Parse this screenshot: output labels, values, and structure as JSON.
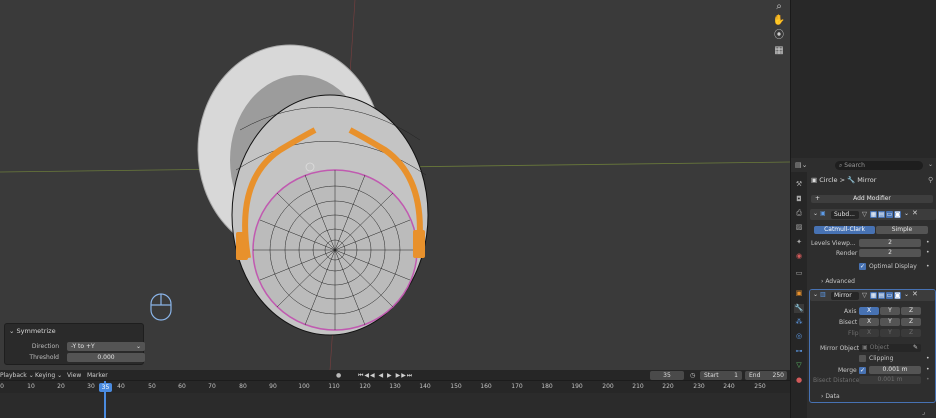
{
  "viewport": {
    "nav_icons": [
      "zoom-icon",
      "hand-icon",
      "camera-icon",
      "grid-icon"
    ]
  },
  "symmetrize": {
    "title": "Symmetrize",
    "direction_label": "Direction",
    "direction_value": "-Y to +Y",
    "threshold_label": "Threshold",
    "threshold_value": "0.000"
  },
  "timeline": {
    "menu": [
      "Playback",
      "Keying",
      "View",
      "Marker"
    ],
    "current_frame": "35",
    "start_label": "Start",
    "start_value": "1",
    "end_label": "End",
    "end_value": "250",
    "playhead_label": "35",
    "ticks": [
      "0",
      "10",
      "20",
      "30",
      "40",
      "50",
      "60",
      "70",
      "80",
      "90",
      "100",
      "110",
      "120",
      "130",
      "140",
      "150",
      "160",
      "170",
      "180",
      "190",
      "200",
      "210",
      "220",
      "230",
      "240",
      "250"
    ]
  },
  "properties": {
    "search_placeholder": "Search",
    "breadcrumb_object": "Circle",
    "breadcrumb_sep": ">",
    "breadcrumb_modifier": "Mirror",
    "add_modifier": "Add Modifier",
    "subsurf": {
      "name": "Subd...",
      "catmull": "Catmull-Clark",
      "simple": "Simple",
      "levels_label": "Levels Viewp...",
      "levels_value": "2",
      "render_label": "Render",
      "render_value": "2",
      "optimal_label": "Optimal Display",
      "advanced_label": "Advanced"
    },
    "mirror": {
      "name": "Mirror",
      "axis_label": "Axis",
      "bisect_label": "Bisect",
      "flip_label": "Flip",
      "x": "X",
      "y": "Y",
      "z": "Z",
      "mirror_object_label": "Mirror Object",
      "object_placeholder": "Object",
      "clipping_label": "Clipping",
      "merge_label": "Merge",
      "merge_value": "0.001 m",
      "bisect_distance_label": "Bisect Distance",
      "bisect_distance_value": "0.001 m",
      "data_label": "Data"
    }
  }
}
